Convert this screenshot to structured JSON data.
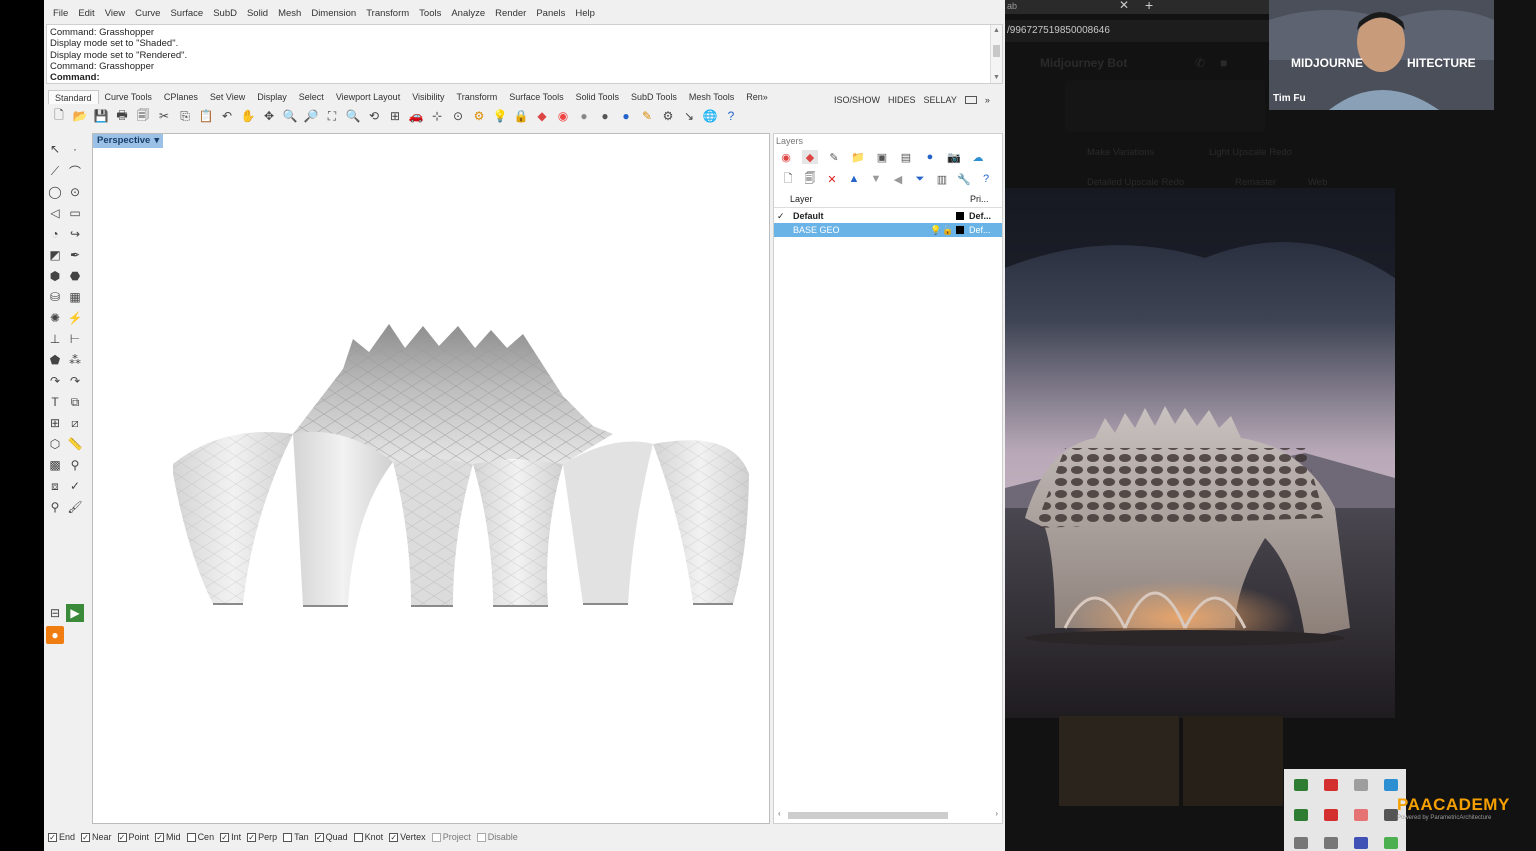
{
  "rhino": {
    "menu": [
      "File",
      "Edit",
      "View",
      "Curve",
      "Surface",
      "SubD",
      "Solid",
      "Mesh",
      "Dimension",
      "Transform",
      "Tools",
      "Analyze",
      "Render",
      "Panels",
      "Help"
    ],
    "command_history": [
      "Command: Grasshopper",
      "Display mode set to \"Shaded\".",
      "Display mode set to \"Rendered\".",
      "Command: Grasshopper"
    ],
    "command_prompt": "Command:",
    "toolbar_tabs": [
      "Standard",
      "Curve Tools",
      "CPlanes",
      "Set View",
      "Display",
      "Select",
      "Viewport Layout",
      "Visibility",
      "Transform",
      "Surface Tools",
      "Solid Tools",
      "SubD Tools",
      "Mesh Tools",
      "Ren»"
    ],
    "right_strip": [
      "ISO/SHOW",
      "HIDES",
      "SELLAY",
      "»"
    ],
    "viewport_label": "Perspective",
    "layers": {
      "title": "Layers",
      "col_layer": "Layer",
      "col_print": "Pri...",
      "rows": [
        {
          "name": "Default",
          "material": "Def...",
          "current": true
        },
        {
          "name": "BASE GEO",
          "material": "Def...",
          "selected": true
        }
      ]
    },
    "snaps": [
      {
        "label": "End",
        "checked": true
      },
      {
        "label": "Near",
        "checked": true
      },
      {
        "label": "Point",
        "checked": true
      },
      {
        "label": "Mid",
        "checked": true
      },
      {
        "label": "Cen",
        "checked": false
      },
      {
        "label": "Int",
        "checked": true
      },
      {
        "label": "Perp",
        "checked": true
      },
      {
        "label": "Tan",
        "checked": false
      },
      {
        "label": "Quad",
        "checked": true
      },
      {
        "label": "Knot",
        "checked": false
      },
      {
        "label": "Vertex",
        "checked": true
      },
      {
        "label": "Project",
        "checked": false
      },
      {
        "label": "Disable",
        "checked": false
      }
    ]
  },
  "browser": {
    "tab_text": "ab",
    "url": "/996727519850008646",
    "bot_name": "Midjourney Bot",
    "buttons": [
      "Make Variations",
      "Light Upscale Redo",
      "Detailed Upscale Redo",
      "Remaster",
      "Web"
    ]
  },
  "video": {
    "banner_left": "MIDJOURNE",
    "banner_right": "HITECTURE",
    "presenter": "Tim Fu"
  },
  "watermark": {
    "brand": "PAACADEMY",
    "sub": "Powered by ParametricArchitecture"
  },
  "colors": {
    "selection": "#6ab3e6",
    "viewport_label": "#9bc2e6",
    "brand_orange": "#f5a000"
  }
}
